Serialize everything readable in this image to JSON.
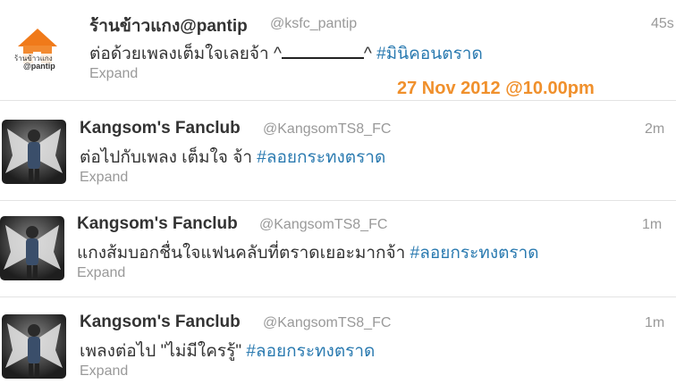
{
  "overlay_date": "27 Nov 2012 @10.00pm",
  "tweets": [
    {
      "name": "ร้านข้าวแกง@pantip",
      "handle": "@ksfc_pantip",
      "time": "45s",
      "text_before": "ต่อด้วยเพลงเต็มใจเลยจ้า ^",
      "text_after": "^ ",
      "hashtag": "#มินิคอนตราด",
      "expand": "Expand",
      "avatar_logo_text": "ร้านข้าวแกง@pantip"
    },
    {
      "name": "Kangsom's Fanclub",
      "handle": "@KangsomTS8_FC",
      "time": "2m",
      "text": "ต่อไปกับเพลง เต็มใจ จ้า ",
      "hashtag": "#ลอยกระทงตราด",
      "expand": "Expand"
    },
    {
      "name": "Kangsom's Fanclub",
      "handle": "@KangsomTS8_FC",
      "time": "1m",
      "text": "แกงส้มบอกชื่นใจแฟนคลับที่ตราดเยอะมากจ้า ",
      "hashtag": "#ลอยกระทงตราด",
      "expand": "Expand"
    },
    {
      "name": "Kangsom's Fanclub",
      "handle": "@KangsomTS8_FC",
      "time": "1m",
      "text": "เพลงต่อไป \"ไม่มีใครรู้\" ",
      "hashtag": "#ลอยกระทงตราด",
      "expand": "Expand"
    }
  ],
  "colors": {
    "hashtag": "#2a7ab0",
    "overlay": "#f0902c",
    "logo_orange": "#f07a1a"
  },
  "icons": {
    "tweet1_avatar": "pantip-house-logo",
    "fanclub_avatar": "winged-person-photo"
  }
}
